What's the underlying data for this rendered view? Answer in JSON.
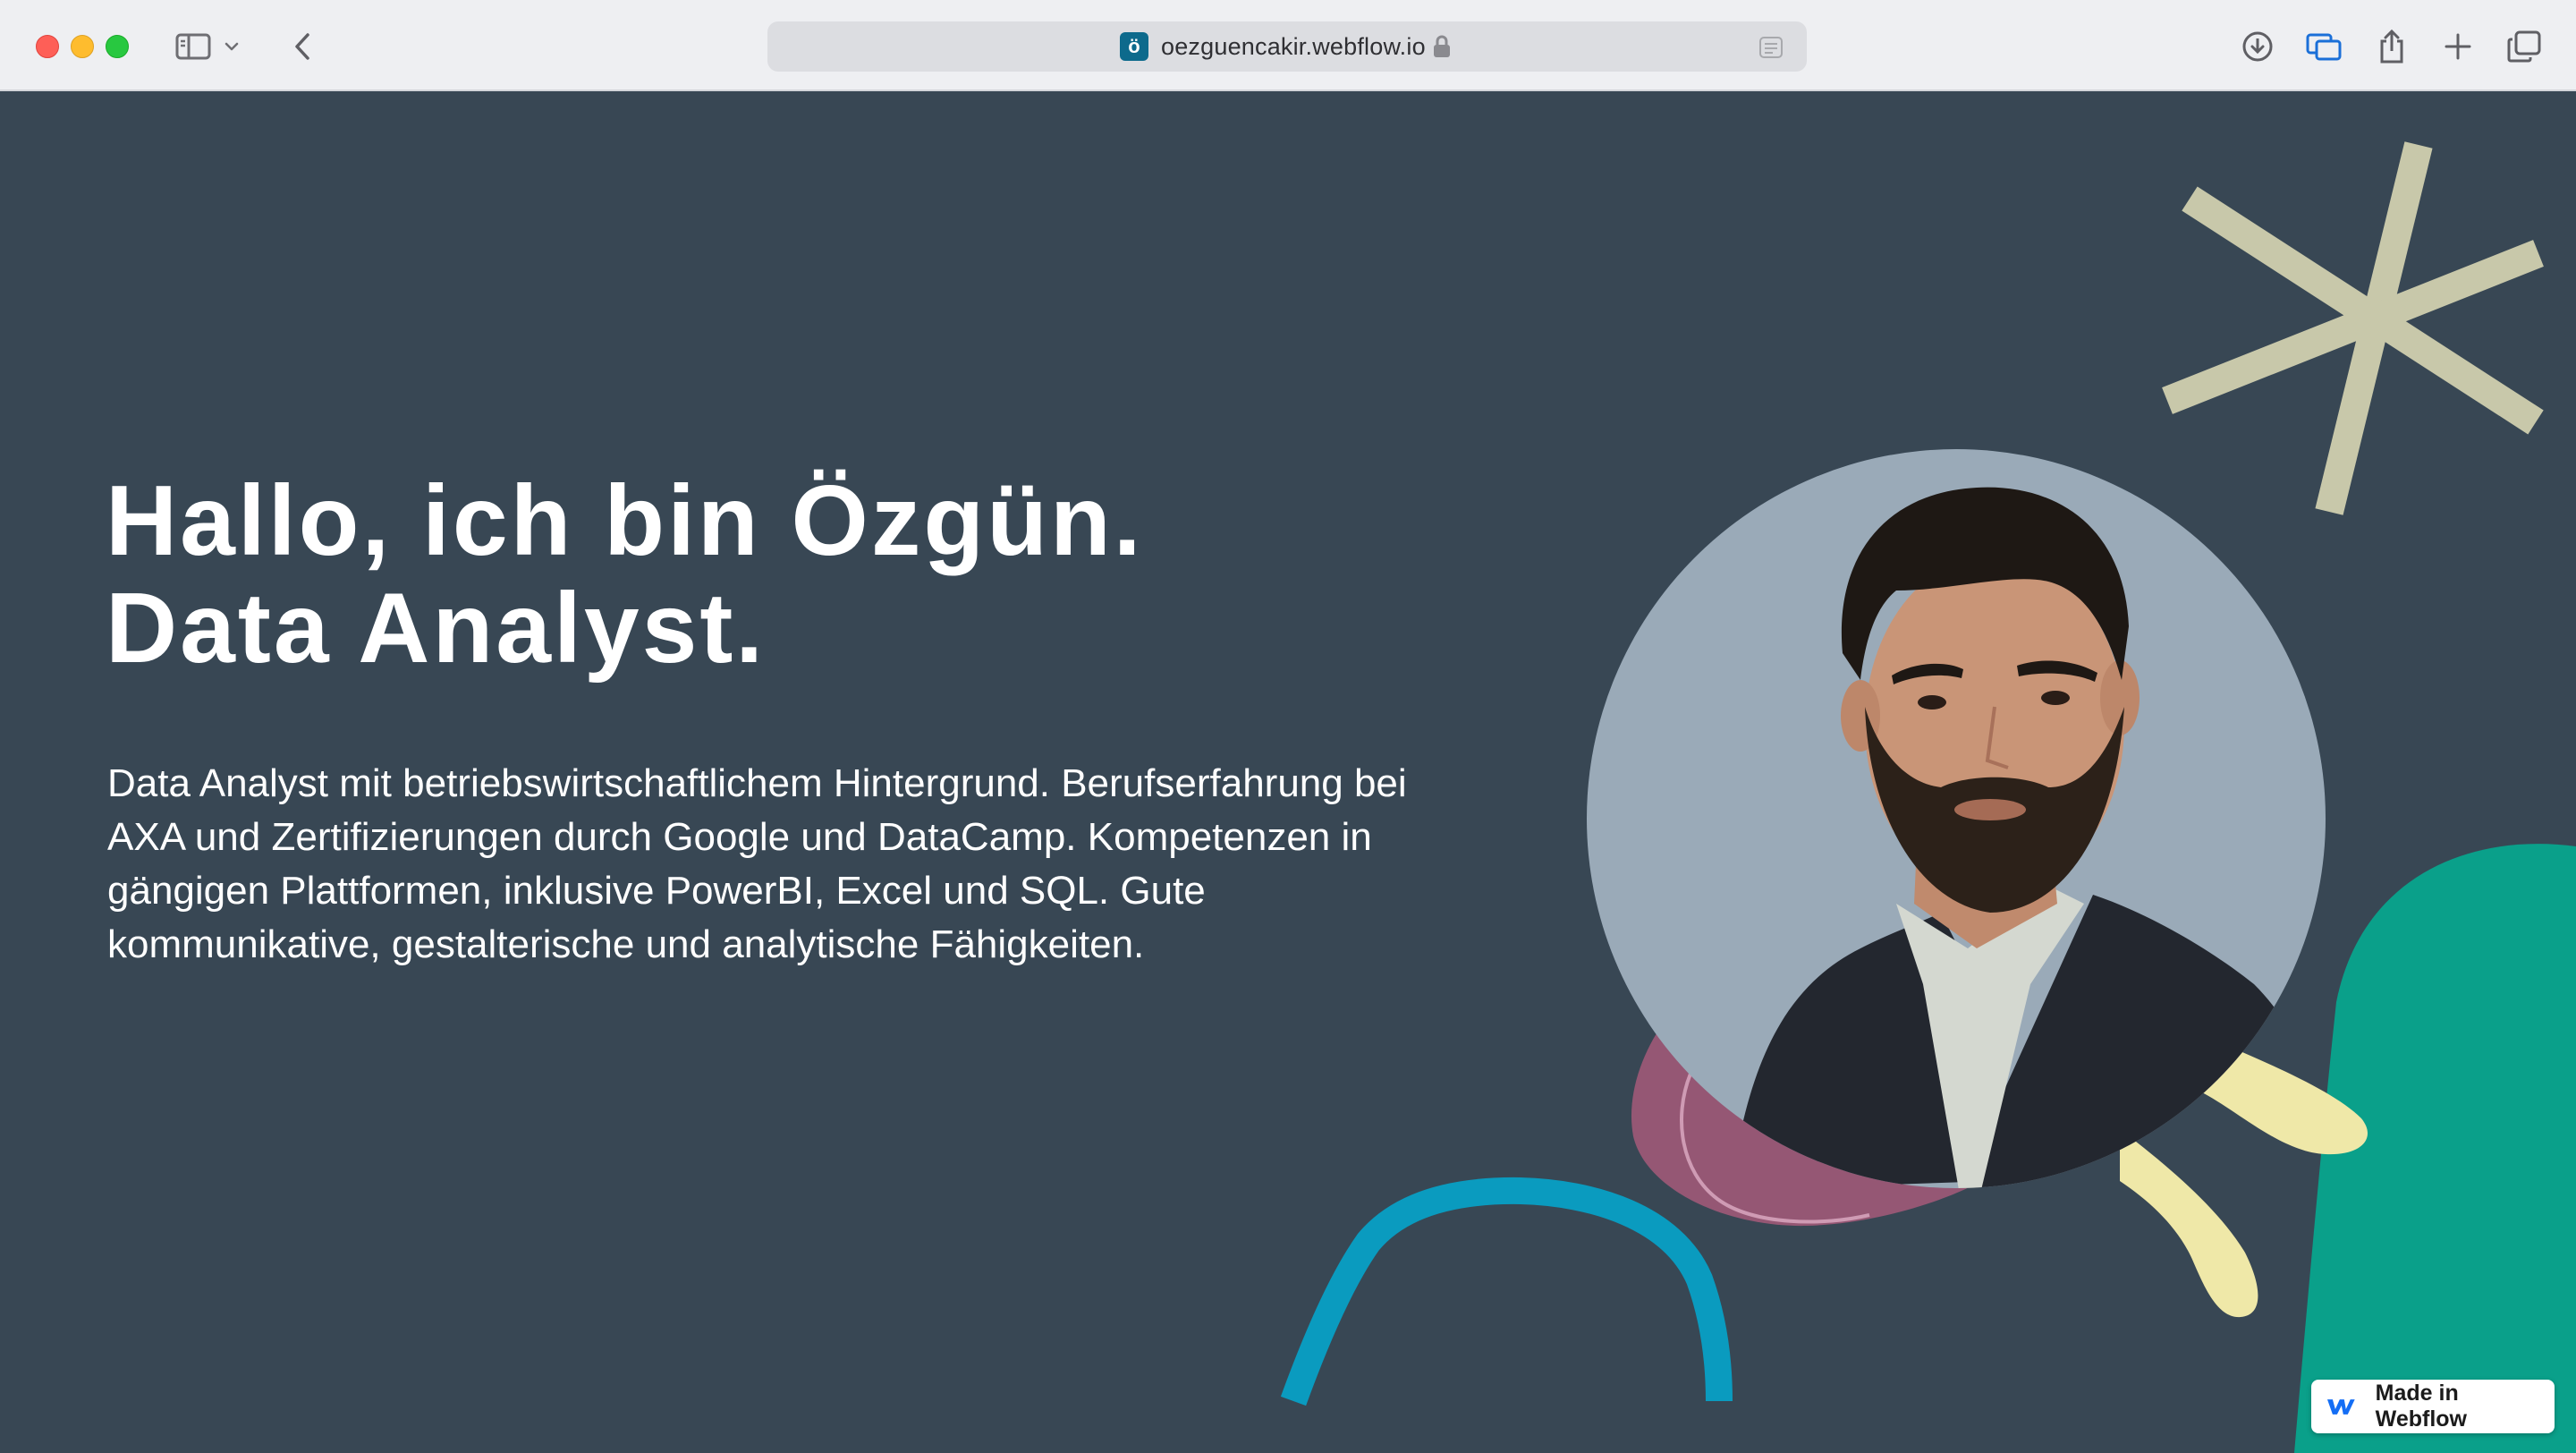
{
  "browser": {
    "url": "oezguencakir.webflow.io",
    "favicon_letter": "ö",
    "icons": [
      "sidebar-icon",
      "chevron-down-icon",
      "back-icon",
      "lock-icon",
      "reader-icon",
      "download-icon",
      "tab-overview-icon",
      "share-icon",
      "new-tab-icon",
      "tabs-icon"
    ]
  },
  "hero": {
    "title_line1": "Hallo, ich bin Özgün.",
    "title_line2": "Data Analyst.",
    "description": "Data Analyst mit betriebswirtschaftlichem Hintergrund. Berufserfahrung bei AXA und Zertifizierungen durch Google und DataCamp. Kompetenzen in gängigen Plattformen, inklusive PowerBI, Excel und SQL. Gute kommunikative, gestalterische und analytische Fähigkeiten."
  },
  "badge": {
    "label": "Made in Webflow"
  },
  "colors": {
    "background": "#384754",
    "asterisk": "#c8c8aa",
    "teal_blob": "#0aa08a",
    "pink_blob": "#955774",
    "blue_arch": "#0a9bbf",
    "yellow_shape": "#efe8a8",
    "portrait_bg": "#9aaab8"
  }
}
